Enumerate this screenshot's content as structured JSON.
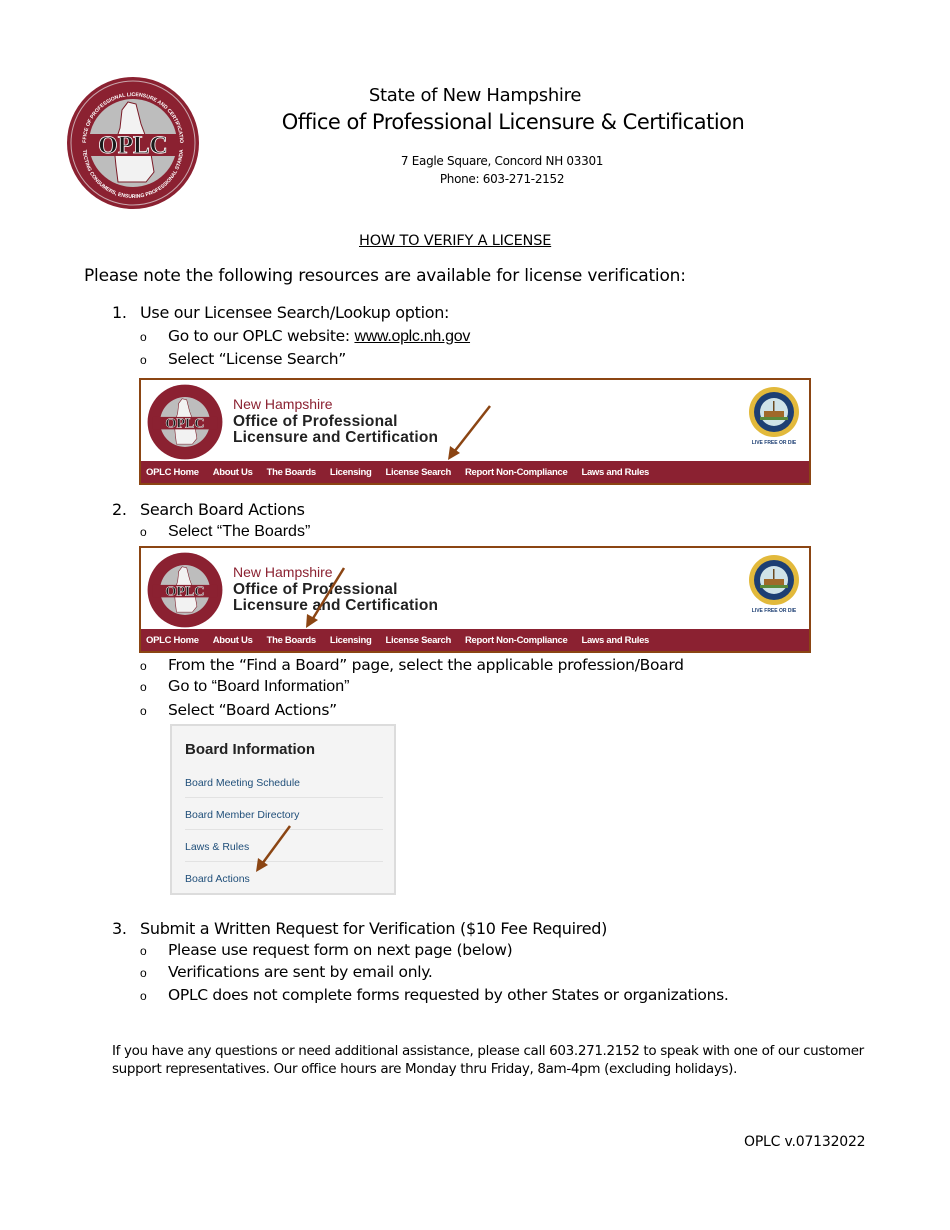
{
  "header": {
    "state": "State of New Hampshire",
    "office": "Office of Professional Licensure & Certification",
    "address": "7 Eagle Square, Concord NH 03301",
    "phone": "Phone: 603-271-2152",
    "logo_text": "OPLC",
    "logo_ring_top": "OFFICE OF PROFESSIONAL LICENSURE AND CERTIFICATION",
    "logo_ring_bottom": "PROTECTING CONSUMERS, ENSURING PROFESSIONAL STANDARDS"
  },
  "document": {
    "title": "HOW TO VERIFY A LICENSE",
    "intro": "Please note the following resources are available for license verification:"
  },
  "steps": [
    {
      "number": "1.",
      "label": "Use our Licensee Search/Lookup option:",
      "bullets": [
        {
          "prefix": "Go to our OPLC website: ",
          "link": "www.oplc.nh.gov"
        },
        {
          "text": "Select “License Search”"
        }
      ]
    },
    {
      "number": "2.",
      "label": "Search Board Actions",
      "bullets": [
        {
          "text": "Select “The Boards”"
        },
        {
          "text": "From the “Find a Board” page, select the applicable profession/Board"
        },
        {
          "text": "Go to “Board Information”"
        },
        {
          "text": "Select “Board Actions”"
        }
      ]
    },
    {
      "number": "3.",
      "label": "Submit a Written Request for Verification ($10 Fee Required)",
      "bullets": [
        {
          "text": "Please use request form on next page (below)"
        },
        {
          "text": "Verifications are sent by email only."
        },
        {
          "text": "OPLC does not complete forms requested by other States or organizations."
        }
      ]
    }
  ],
  "banner": {
    "state": "New Hampshire",
    "title_line1": "Office of Professional",
    "title_line2": "Licensure and Certification",
    "logo_text": "OPLC",
    "seal_motto": "LIVE FREE OR DIE",
    "nav": [
      "OPLC Home",
      "About Us",
      "The Boards",
      "Licensing",
      "License Search",
      "Report Non-Compliance",
      "Laws and Rules"
    ]
  },
  "board_info": {
    "title": "Board Information",
    "items": [
      "Board Meeting Schedule",
      "Board Member Directory",
      "Laws & Rules",
      "Board Actions"
    ]
  },
  "footer": {
    "note": "If you have any questions or need additional assistance, please call 603.271.2152 to speak with one of our customer support representatives. Our office hours are Monday thru Friday, 8am-4pm (excluding holidays).",
    "version": "OPLC v.07132022"
  },
  "colors": {
    "brand_maroon": "#8b2131",
    "arrow_brown": "#8b4513",
    "link_blue": "#1f4e79"
  }
}
